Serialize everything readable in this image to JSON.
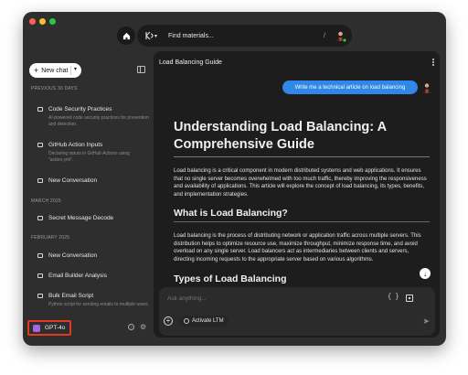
{
  "window": {
    "traffic_colors": [
      "#ff5f57",
      "#febc2e",
      "#28c840"
    ]
  },
  "topbar": {
    "home_icon": "home-icon",
    "search_placeholder": "Find materials...",
    "search_shortcut": "/",
    "logo_caret": "▾"
  },
  "sidebar": {
    "new_chat_label": "New chat",
    "sections": [
      {
        "label": "PREVIOUS 30 DAYS",
        "items": [
          {
            "title": "Code Security Practices",
            "desc": "AI-powered code security practices for prevention and detection."
          },
          {
            "title": "GitHub Action Inputs",
            "desc": "Declaring inputs in GitHub Actions using \"action.yml\"."
          },
          {
            "title": "New Conversation",
            "desc": ""
          }
        ]
      },
      {
        "label": "MARCH 2025",
        "items": [
          {
            "title": "Secret Message Decode",
            "desc": ""
          }
        ]
      },
      {
        "label": "FEBRUARY 2025",
        "items": [
          {
            "title": "New Conversation",
            "desc": ""
          },
          {
            "title": "Email Builder Analysis",
            "desc": ""
          },
          {
            "title": "Bulk Email Script",
            "desc": "Python script for sending emails to multiple users."
          }
        ]
      }
    ],
    "model_label": "GPT-4o",
    "model_color": "#a266e0",
    "highlight_color": "#e23a1f"
  },
  "main": {
    "title": "Load Balancing Guide",
    "user_message": "Write me a technical article on load balancing",
    "user_message_color": "#2f87e8",
    "article": {
      "h1": "Understanding Load Balancing: A Comprehensive Guide",
      "intro": "Load balancing is a critical component in modern distributed systems and web applications. It ensures that no single server becomes overwhelmed with too much traffic, thereby improving the responsiveness and availability of applications. This article will explore the concept of load balancing, its types, benefits, and implementation strategies.",
      "h2_what": "What is Load Balancing?",
      "what_body": "Load balancing is the process of distributing network or application traffic across multiple servers. This distribution helps to optimize resource use, maximize throughput, minimize response time, and avoid overload on any single server. Load balancers act as intermediaries between clients and servers, directing incoming requests to the appropriate server based on various algorithms.",
      "h2_types": "Types of Load Balancing"
    },
    "composer": {
      "placeholder": "Ask anything...",
      "ltm_label": "Activate LTM",
      "code_glyph": "{ }"
    }
  }
}
